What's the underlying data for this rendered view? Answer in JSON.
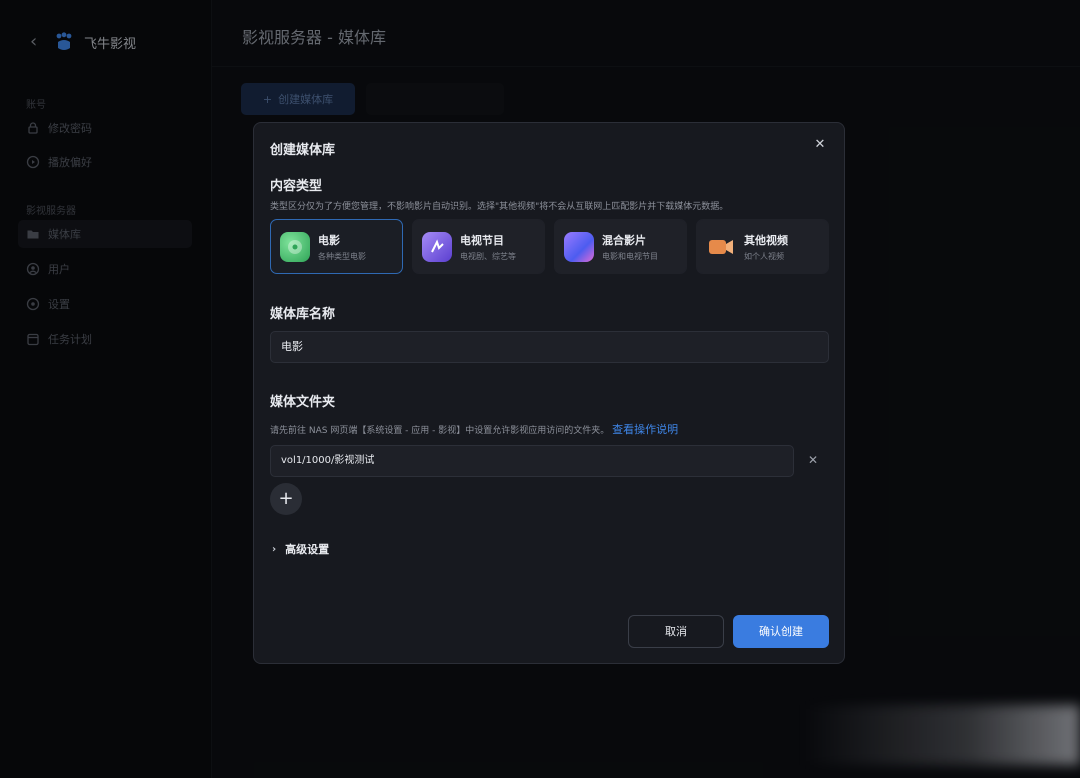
{
  "app": {
    "name": "飞牛影视"
  },
  "sidebar": {
    "sections": [
      {
        "title": "账号",
        "items": [
          {
            "label": "修改密码",
            "icon": "lock-icon"
          },
          {
            "label": "播放偏好",
            "icon": "play-circle-icon"
          }
        ]
      },
      {
        "title": "影视服务器",
        "items": [
          {
            "label": "媒体库",
            "icon": "folder-icon",
            "active": true
          },
          {
            "label": "用户",
            "icon": "user-icon"
          },
          {
            "label": "设置",
            "icon": "gear-icon"
          },
          {
            "label": "任务计划",
            "icon": "calendar-icon"
          }
        ]
      }
    ]
  },
  "page": {
    "title": "影视服务器 - 媒体库",
    "create_button": "创建媒体库",
    "secondary_button": ""
  },
  "modal": {
    "title": "创建媒体库",
    "content_type": {
      "title": "内容类型",
      "hint": "类型区分仅为了方便您管理，不影响影片自动识别。选择\"其他视频\"将不会从互联网上匹配影片并下载媒体元数据。",
      "options": [
        {
          "title": "电影",
          "desc": "各种类型电影",
          "icon": "movie-icon",
          "selected": true,
          "color": "#3fbf6a"
        },
        {
          "title": "电视节目",
          "desc": "电视剧、综艺等",
          "icon": "tv-icon",
          "selected": false,
          "color": "#7b62e0"
        },
        {
          "title": "混合影片",
          "desc": "电影和电视节目",
          "icon": "mixed-icon",
          "selected": false,
          "color": "#6d56e8"
        },
        {
          "title": "其他视频",
          "desc": "如个人视频",
          "icon": "camera-icon",
          "selected": false,
          "color": "#e68a4a"
        }
      ]
    },
    "name_section": {
      "title": "媒体库名称",
      "value": "电影"
    },
    "folder_section": {
      "title": "媒体文件夹",
      "hint": "请先前往 NAS 网页端【系统设置 - 应用 - 影视】中设置允许影视应用访问的文件夹。",
      "hint_link": "查看操作说明",
      "path": "vol1/1000/影视测试"
    },
    "advanced_label": "高级设置",
    "cancel_label": "取消",
    "confirm_label": "确认创建"
  }
}
